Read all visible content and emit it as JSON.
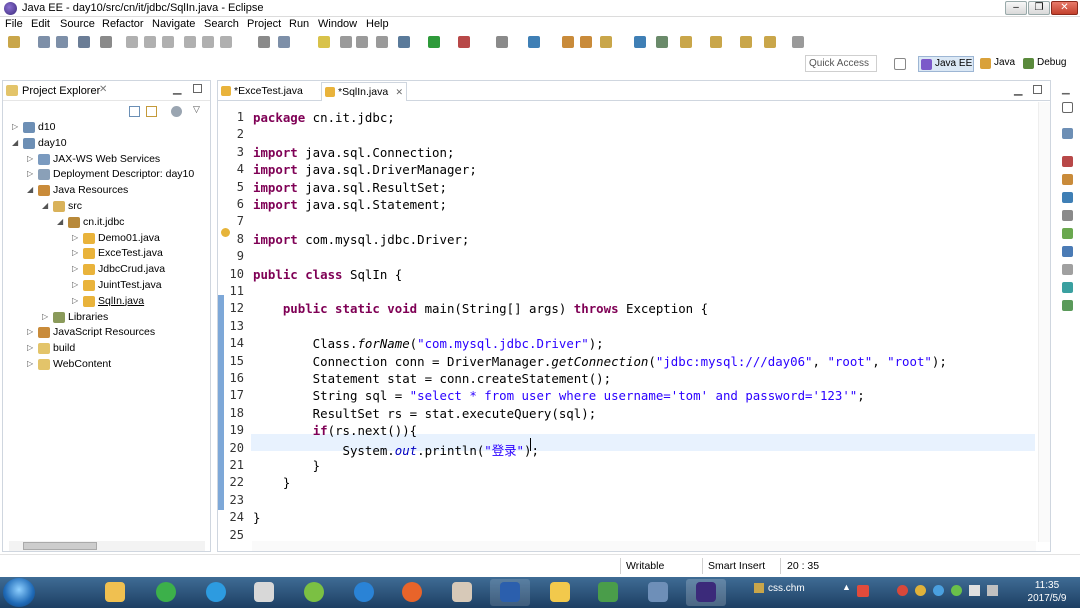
{
  "window": {
    "title": "Java EE - day10/src/cn/it/jdbc/SqlIn.java - Eclipse"
  },
  "menu": [
    "File",
    "Edit",
    "Source",
    "Refactor",
    "Navigate",
    "Search",
    "Project",
    "Run",
    "Window",
    "Help"
  ],
  "toolbar": {
    "quick_access": "Quick Access"
  },
  "perspectives": {
    "javaee": "Java EE",
    "java": "Java",
    "debug": "Debug"
  },
  "explorer": {
    "title": "Project Explorer",
    "items": [
      {
        "label": "d10",
        "depth": 0,
        "icon": "project-icon",
        "twisty": "closed"
      },
      {
        "label": "day10",
        "depth": 0,
        "icon": "project-icon",
        "twisty": "open"
      },
      {
        "label": "JAX-WS Web Services",
        "depth": 1,
        "icon": "webservice-icon",
        "twisty": "closed"
      },
      {
        "label": "Deployment Descriptor: day10",
        "depth": 1,
        "icon": "descriptor-icon",
        "twisty": "closed"
      },
      {
        "label": "Java Resources",
        "depth": 1,
        "icon": "java-resources-icon",
        "twisty": "open"
      },
      {
        "label": "src",
        "depth": 2,
        "icon": "source-folder-icon",
        "twisty": "open"
      },
      {
        "label": "cn.it.jdbc",
        "depth": 3,
        "icon": "package-icon",
        "twisty": "open"
      },
      {
        "label": "Demo01.java",
        "depth": 4,
        "icon": "java-file-icon",
        "twisty": "closed"
      },
      {
        "label": "ExceTest.java",
        "depth": 4,
        "icon": "java-file-icon",
        "twisty": "closed"
      },
      {
        "label": "JdbcCrud.java",
        "depth": 4,
        "icon": "java-file-icon",
        "twisty": "closed"
      },
      {
        "label": "JuintTest.java",
        "depth": 4,
        "icon": "java-file-icon",
        "twisty": "closed"
      },
      {
        "label": "SqlIn.java",
        "depth": 4,
        "icon": "java-file-icon",
        "twisty": "closed",
        "selected": true
      },
      {
        "label": "Libraries",
        "depth": 2,
        "icon": "library-icon",
        "twisty": "closed"
      },
      {
        "label": "JavaScript Resources",
        "depth": 1,
        "icon": "js-resources-icon",
        "twisty": "closed"
      },
      {
        "label": "build",
        "depth": 1,
        "icon": "folder-icon",
        "twisty": "closed"
      },
      {
        "label": "WebContent",
        "depth": 1,
        "icon": "folder-icon",
        "twisty": "closed"
      }
    ]
  },
  "editor": {
    "tabs": [
      {
        "label": "*ExceTest.java",
        "active": false
      },
      {
        "label": "*SqlIn.java",
        "active": true
      }
    ],
    "lines": [
      [
        [
          "kw",
          "package"
        ],
        [
          "t",
          " cn.it.jdbc;"
        ]
      ],
      [],
      [
        [
          "kw",
          "import"
        ],
        [
          "t",
          " java.sql.Connection;"
        ]
      ],
      [
        [
          "kw",
          "import"
        ],
        [
          "t",
          " java.sql.DriverManager;"
        ]
      ],
      [
        [
          "kw",
          "import"
        ],
        [
          "t",
          " java.sql.ResultSet;"
        ]
      ],
      [
        [
          "kw",
          "import"
        ],
        [
          "t",
          " java.sql.Statement;"
        ]
      ],
      [],
      [
        [
          "kw",
          "import"
        ],
        [
          "t",
          " com.mysql.jdbc.Driver;"
        ]
      ],
      [],
      [
        [
          "kw",
          "public class"
        ],
        [
          "t",
          " SqlIn {"
        ]
      ],
      [],
      [
        [
          "t",
          "    "
        ],
        [
          "kw",
          "public static void"
        ],
        [
          "t",
          " main(String[] args) "
        ],
        [
          "kw",
          "throws"
        ],
        [
          "t",
          " Exception {"
        ]
      ],
      [],
      [
        [
          "t",
          "        Class."
        ],
        [
          "it",
          "forName"
        ],
        [
          "t",
          "("
        ],
        [
          "str",
          "\"com.mysql.jdbc.Driver\""
        ],
        [
          "t",
          ");"
        ]
      ],
      [
        [
          "t",
          "        Connection conn = DriverManager."
        ],
        [
          "it",
          "getConnection"
        ],
        [
          "t",
          "("
        ],
        [
          "str",
          "\"jdbc:mysql:///day06\""
        ],
        [
          "t",
          ", "
        ],
        [
          "str",
          "\"root\""
        ],
        [
          "t",
          ", "
        ],
        [
          "str",
          "\"root\""
        ],
        [
          "t",
          ");"
        ]
      ],
      [
        [
          "t",
          "        Statement stat = conn.createStatement();"
        ]
      ],
      [
        [
          "t",
          "        String sql = "
        ],
        [
          "str",
          "\"select * from user where username='tom' and password='123'\""
        ],
        [
          "t",
          ";"
        ]
      ],
      [
        [
          "t",
          "        ResultSet rs = stat.executeQuery(sql);"
        ]
      ],
      [
        [
          "t",
          "        "
        ],
        [
          "kw",
          "if"
        ],
        [
          "t",
          "(rs.next()){"
        ]
      ],
      [
        [
          "t",
          "            System."
        ],
        [
          "fld",
          "out"
        ],
        [
          "t",
          ".println("
        ],
        [
          "str",
          "\"登录\""
        ],
        [
          "t",
          ");"
        ]
      ],
      [
        [
          "t",
          "        }"
        ]
      ],
      [
        [
          "t",
          "    }"
        ]
      ],
      [],
      [
        [
          "t",
          "}"
        ]
      ],
      []
    ]
  },
  "status": {
    "writable": "Writable",
    "insert_mode": "Smart Insert",
    "position": "20 : 35"
  },
  "taskbar": {
    "tray_file": "css.chm",
    "clock_time": "11:35",
    "clock_date": "2017/5/9"
  }
}
